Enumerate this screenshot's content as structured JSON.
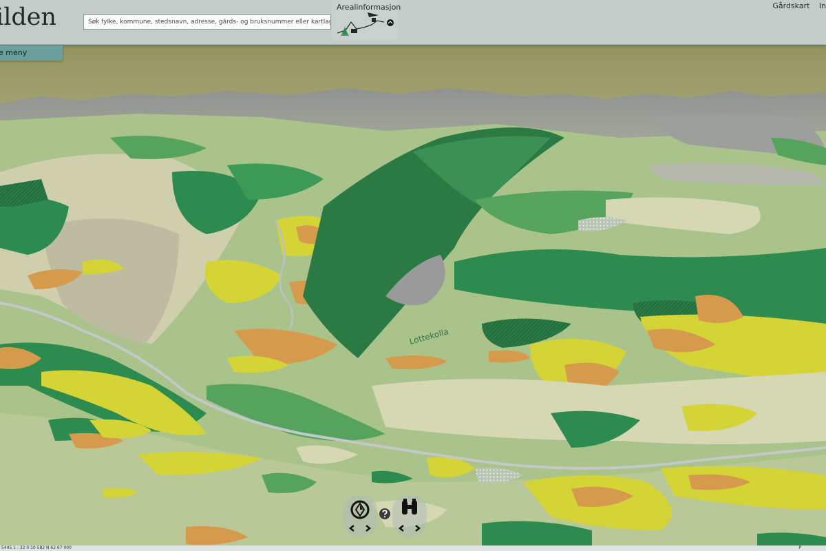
{
  "header": {
    "logo_text": "ilden",
    "search_placeholder": "Søk fylke, kommune, stedsnavn, adresse, gårds- og bruksnummer eller kartlag.",
    "areal_title": "Arealinformasjon",
    "nav": [
      "Gårdskart",
      "Inf"
    ]
  },
  "menu": {
    "label": "e meny"
  },
  "map": {
    "place_label": "Lottekolla"
  },
  "footer": {
    "scale_text": "5445  1 :  32 0 10 582 N 62 67 000 ",
    "right_text": "P"
  },
  "colors": {
    "sky": "#9a9a66",
    "dark_forest": "#2e8b4f",
    "forest": "#56a35e",
    "light_green": "#a9c38a",
    "cream": "#d6d7b3",
    "yellow": "#d4d437",
    "orange": "#d69a4c",
    "rock_grey": "#9a9a9a"
  },
  "icons": [
    "compass-icon",
    "help-icon",
    "binoculars-icon",
    "chevron-left-icon",
    "chevron-right-icon"
  ]
}
